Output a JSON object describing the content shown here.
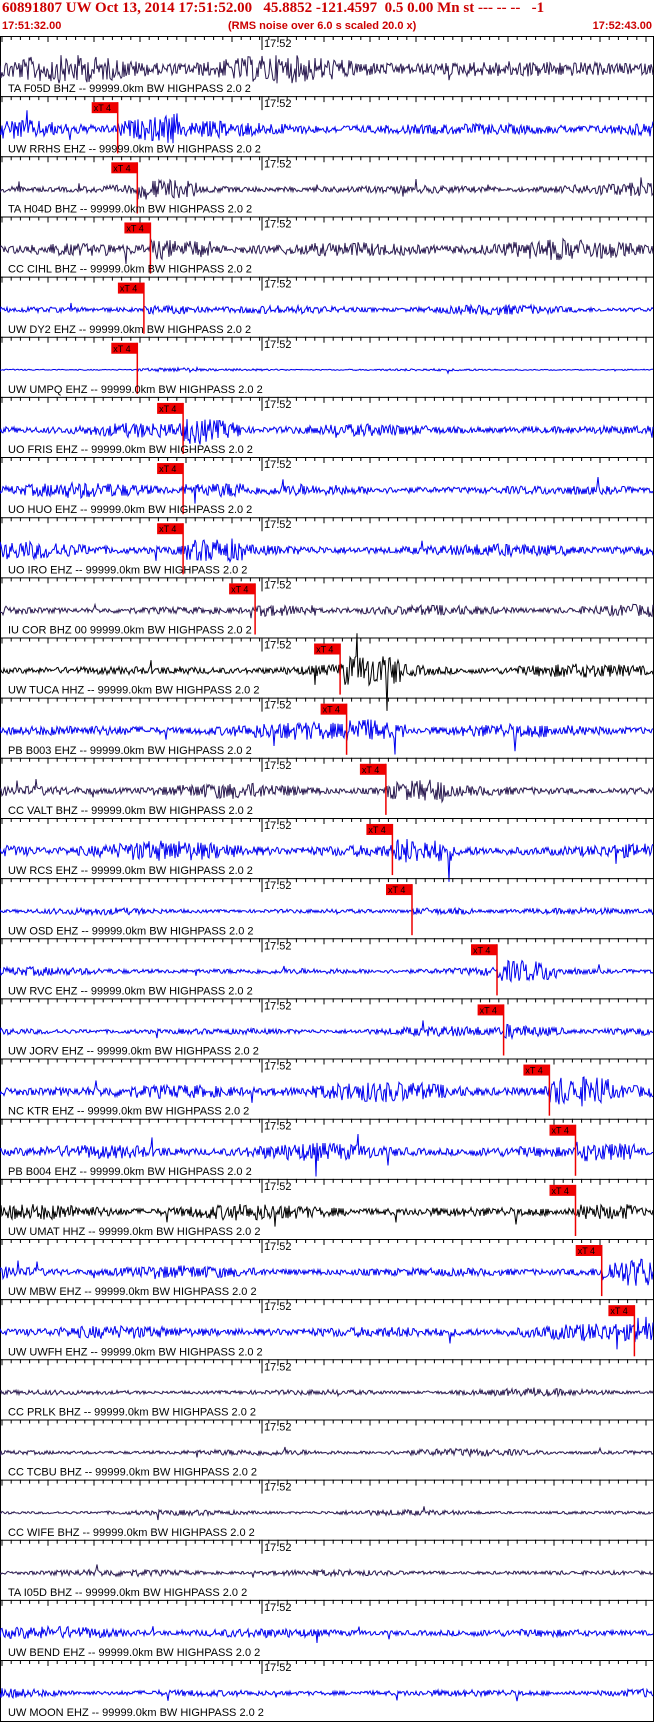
{
  "header": {
    "title": "60891807 UW Oct 13, 2014 17:51:52.00   45.8852 -121.4597  0.5 0.00 Mn st --- -- --   -1",
    "start_time": "17:51:32.00",
    "noise_note": "(RMS noise over 6.0 s scaled 20.0 x)",
    "end_time": "17:52:43.00"
  },
  "colors": {
    "header_text": "#cc0000",
    "trace_blue": "#0000ee",
    "trace_dark": "#2a1a50",
    "trace_black": "#000000",
    "pick_marker": "#ee0000",
    "border": "#000000"
  },
  "chart_data": {
    "type": "seismogram",
    "minute_label": "17:52",
    "pick_label": "xT 4",
    "time_range": [
      "17:51:32.00",
      "17:52:43.00"
    ],
    "traces": [
      {
        "label": "TA F05D BHZ -- 99999.0km BW  HIGHPASS  2.0  2",
        "color": "dark",
        "amp": 0.6,
        "pick": null
      },
      {
        "label": "UW RRHS EHZ -- 99999.0km BW  HIGHPASS  2.0  2",
        "color": "blue",
        "amp": 0.4,
        "pick": 0.18
      },
      {
        "label": "TA H04D BHZ -- 99999.0km BW  HIGHPASS  2.0  2",
        "color": "dark",
        "amp": 0.25,
        "pick": 0.21
      },
      {
        "label": "CC CIHL BHZ -- 99999.0km BW  HIGHPASS  2.0  2",
        "color": "dark",
        "amp": 0.4,
        "pick": 0.23
      },
      {
        "label": "UW DY2 EHZ -- 99999.0km BW  HIGHPASS  2.0  2",
        "color": "blue",
        "amp": 0.2,
        "pick": 0.22
      },
      {
        "label": "UW UMPQ EHZ -- 99999.0km BW  HIGHPASS  2.0  2",
        "color": "blue",
        "amp": 0.05,
        "pick": 0.21
      },
      {
        "label": "UO FRIS EHZ -- 99999.0km BW  HIGHPASS  2.0  2",
        "color": "blue",
        "amp": 0.3,
        "pick": 0.28
      },
      {
        "label": "UO HUO EHZ -- 99999.0km BW  HIGHPASS  2.0  2",
        "color": "blue",
        "amp": 0.3,
        "pick": 0.28
      },
      {
        "label": "UO IRO EHZ -- 99999.0km BW  HIGHPASS  2.0  2",
        "color": "blue",
        "amp": 0.35,
        "pick": 0.28
      },
      {
        "label": "IU COR BHZ 00 99999.0km BW  HIGHPASS  2.0  2",
        "color": "dark",
        "amp": 0.25,
        "pick": 0.39
      },
      {
        "label": "UW TUCA HHZ -- 99999.0km BW  HIGHPASS  2.0  2",
        "color": "black",
        "amp": 0.3,
        "pick": 0.52
      },
      {
        "label": "PB B003 EHZ -- 99999.0km BW  HIGHPASS  2.0  2",
        "color": "blue",
        "amp": 0.35,
        "pick": 0.53
      },
      {
        "label": "CC VALT BHZ -- 99999.0km BW  HIGHPASS  2.0  2",
        "color": "dark",
        "amp": 0.3,
        "pick": 0.59
      },
      {
        "label": "UW RCS EHZ -- 99999.0km BW  HIGHPASS  2.0  2",
        "color": "blue",
        "amp": 0.4,
        "pick": 0.6
      },
      {
        "label": "UW OSD EHZ -- 99999.0km BW  HIGHPASS  2.0  2",
        "color": "blue",
        "amp": 0.15,
        "pick": 0.63
      },
      {
        "label": "UW RVC EHZ -- 99999.0km BW  HIGHPASS  2.0  2",
        "color": "blue",
        "amp": 0.2,
        "pick": 0.76
      },
      {
        "label": "UW JORV EHZ -- 99999.0km BW  HIGHPASS  2.0  2",
        "color": "blue",
        "amp": 0.2,
        "pick": 0.77
      },
      {
        "label": "NC KTR EHZ -- 99999.0km BW  HIGHPASS  2.0  2",
        "color": "blue",
        "amp": 0.4,
        "pick": 0.84
      },
      {
        "label": "PB B004 EHZ -- 99999.0km BW  HIGHPASS  2.0  2",
        "color": "blue",
        "amp": 0.35,
        "pick": 0.88
      },
      {
        "label": "UW UMAT HHZ -- 99999.0km BW  HIGHPASS  2.0  2",
        "color": "black",
        "amp": 0.35,
        "pick": 0.88
      },
      {
        "label": "UW MBW EHZ -- 99999.0km BW  HIGHPASS  2.0  2",
        "color": "blue",
        "amp": 0.3,
        "pick": 0.92
      },
      {
        "label": "UW UWFH EHZ -- 99999.0km BW  HIGHPASS  2.0  2",
        "color": "blue",
        "amp": 0.35,
        "pick": 0.97
      },
      {
        "label": "CC PRLK BHZ -- 99999.0km BW  HIGHPASS  2.0  2",
        "color": "dark",
        "amp": 0.15,
        "pick": null
      },
      {
        "label": "CC TCBU BHZ -- 99999.0km BW  HIGHPASS  2.0  2",
        "color": "dark",
        "amp": 0.15,
        "pick": null
      },
      {
        "label": "CC WIFE BHZ -- 99999.0km BW  HIGHPASS  2.0  2",
        "color": "dark",
        "amp": 0.12,
        "pick": null
      },
      {
        "label": "TA I05D BHZ -- 99999.0km BW  HIGHPASS  2.0  2",
        "color": "dark",
        "amp": 0.15,
        "pick": null
      },
      {
        "label": "UW BEND EHZ -- 99999.0km BW  HIGHPASS  2.0  2",
        "color": "blue",
        "amp": 0.25,
        "pick": null
      },
      {
        "label": "UW MOON EHZ -- 99999.0km BW  HIGHPASS  2.0  2",
        "color": "blue",
        "amp": 0.2,
        "pick": null
      }
    ]
  }
}
